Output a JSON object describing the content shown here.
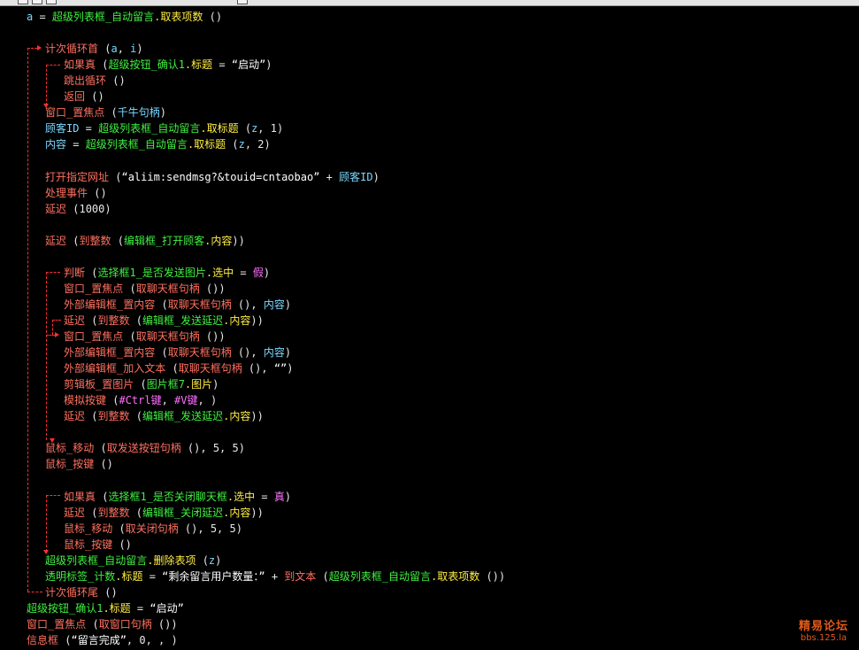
{
  "code": {
    "lines": [
      [
        {
          "t": "a",
          "c": "c-var"
        },
        {
          "t": " = ",
          "c": "c-op"
        },
        {
          "t": "超级列表框_自动留言",
          "c": "c-obj"
        },
        {
          "t": ".取表项数",
          "c": "c-fn"
        },
        {
          "t": " ()",
          "c": "c-op"
        }
      ],
      [],
      [
        {
          "t": "计次循环首",
          "c": "c-kw"
        },
        {
          "t": " (",
          "c": "c-op"
        },
        {
          "t": "a",
          "c": "c-var"
        },
        {
          "t": ", ",
          "c": "c-op"
        },
        {
          "t": "i",
          "c": "c-var"
        },
        {
          "t": ")",
          "c": "c-op"
        }
      ],
      [
        {
          "t": "如果真",
          "c": "c-kw"
        },
        {
          "t": " (",
          "c": "c-op"
        },
        {
          "t": "超级按钮_确认1",
          "c": "c-obj"
        },
        {
          "t": ".标题",
          "c": "c-fn"
        },
        {
          "t": " = ",
          "c": "c-op"
        },
        {
          "t": "“启动”",
          "c": "c-str"
        },
        {
          "t": ")",
          "c": "c-op"
        }
      ],
      [
        {
          "t": "跳出循环",
          "c": "c-kw"
        },
        {
          "t": " ()",
          "c": "c-op"
        }
      ],
      [
        {
          "t": "返回",
          "c": "c-kw"
        },
        {
          "t": " ()",
          "c": "c-op"
        }
      ],
      [
        {
          "t": "窗口_置焦点",
          "c": "c-kw"
        },
        {
          "t": " (",
          "c": "c-op"
        },
        {
          "t": "千牛句柄",
          "c": "c-var"
        },
        {
          "t": ")",
          "c": "c-op"
        }
      ],
      [
        {
          "t": "顾客ID",
          "c": "c-var"
        },
        {
          "t": " = ",
          "c": "c-op"
        },
        {
          "t": "超级列表框_自动留言",
          "c": "c-obj"
        },
        {
          "t": ".取标题",
          "c": "c-fn"
        },
        {
          "t": " (",
          "c": "c-op"
        },
        {
          "t": "z",
          "c": "c-var"
        },
        {
          "t": ", 1)",
          "c": "c-num"
        }
      ],
      [
        {
          "t": "内容",
          "c": "c-var"
        },
        {
          "t": " = ",
          "c": "c-op"
        },
        {
          "t": "超级列表框_自动留言",
          "c": "c-obj"
        },
        {
          "t": ".取标题",
          "c": "c-fn"
        },
        {
          "t": " (",
          "c": "c-op"
        },
        {
          "t": "z",
          "c": "c-var"
        },
        {
          "t": ", 2)",
          "c": "c-num"
        }
      ],
      [],
      [
        {
          "t": "打开指定网址",
          "c": "c-kw"
        },
        {
          "t": " (",
          "c": "c-op"
        },
        {
          "t": "“aliim:sendmsg?&touid=cntaobao”",
          "c": "c-str"
        },
        {
          "t": " + ",
          "c": "c-op"
        },
        {
          "t": "顾客ID",
          "c": "c-var"
        },
        {
          "t": ")",
          "c": "c-op"
        }
      ],
      [
        {
          "t": "处理事件",
          "c": "c-kw"
        },
        {
          "t": " ()",
          "c": "c-op"
        }
      ],
      [
        {
          "t": "延迟",
          "c": "c-kw"
        },
        {
          "t": " (1000)",
          "c": "c-num"
        }
      ],
      [],
      [
        {
          "t": "延迟",
          "c": "c-kw"
        },
        {
          "t": " (",
          "c": "c-op"
        },
        {
          "t": "到整数",
          "c": "c-kw"
        },
        {
          "t": " (",
          "c": "c-op"
        },
        {
          "t": "编辑框_打开顾客",
          "c": "c-obj"
        },
        {
          "t": ".内容",
          "c": "c-fn"
        },
        {
          "t": "))",
          "c": "c-op"
        }
      ],
      [],
      [
        {
          "t": "判断",
          "c": "c-kw"
        },
        {
          "t": " (",
          "c": "c-op"
        },
        {
          "t": "选择框1_是否发送图片",
          "c": "c-obj"
        },
        {
          "t": ".选中",
          "c": "c-fn"
        },
        {
          "t": " = ",
          "c": "c-op"
        },
        {
          "t": "假",
          "c": "c-bool"
        },
        {
          "t": ")",
          "c": "c-op"
        }
      ],
      [
        {
          "t": "窗口_置焦点",
          "c": "c-kw"
        },
        {
          "t": " (",
          "c": "c-op"
        },
        {
          "t": "取聊天框句柄",
          "c": "c-kw"
        },
        {
          "t": " ())",
          "c": "c-op"
        }
      ],
      [
        {
          "t": "外部编辑框_置内容",
          "c": "c-kw"
        },
        {
          "t": " (",
          "c": "c-op"
        },
        {
          "t": "取聊天框句柄",
          "c": "c-kw"
        },
        {
          "t": " (), ",
          "c": "c-op"
        },
        {
          "t": "内容",
          "c": "c-var"
        },
        {
          "t": ")",
          "c": "c-op"
        }
      ],
      [
        {
          "t": "延迟",
          "c": "c-kw"
        },
        {
          "t": " (",
          "c": "c-op"
        },
        {
          "t": "到整数",
          "c": "c-kw"
        },
        {
          "t": " (",
          "c": "c-op"
        },
        {
          "t": "编辑框_发送延迟",
          "c": "c-obj"
        },
        {
          "t": ".内容",
          "c": "c-fn"
        },
        {
          "t": "))",
          "c": "c-op"
        }
      ],
      [
        {
          "t": "窗口_置焦点",
          "c": "c-kw"
        },
        {
          "t": " (",
          "c": "c-op"
        },
        {
          "t": "取聊天框句柄",
          "c": "c-kw"
        },
        {
          "t": " ())",
          "c": "c-op"
        }
      ],
      [
        {
          "t": "外部编辑框_置内容",
          "c": "c-kw"
        },
        {
          "t": " (",
          "c": "c-op"
        },
        {
          "t": "取聊天框句柄",
          "c": "c-kw"
        },
        {
          "t": " (), ",
          "c": "c-op"
        },
        {
          "t": "内容",
          "c": "c-var"
        },
        {
          "t": ")",
          "c": "c-op"
        }
      ],
      [
        {
          "t": "外部编辑框_加入文本",
          "c": "c-kw"
        },
        {
          "t": " (",
          "c": "c-op"
        },
        {
          "t": "取聊天框句柄",
          "c": "c-kw"
        },
        {
          "t": " (), ",
          "c": "c-op"
        },
        {
          "t": "“”",
          "c": "c-str"
        },
        {
          "t": ")",
          "c": "c-op"
        }
      ],
      [
        {
          "t": "剪辑板_置图片",
          "c": "c-kw"
        },
        {
          "t": " (",
          "c": "c-op"
        },
        {
          "t": "图片框7",
          "c": "c-obj"
        },
        {
          "t": ".图片",
          "c": "c-fn"
        },
        {
          "t": ")",
          "c": "c-op"
        }
      ],
      [
        {
          "t": "模拟按键",
          "c": "c-kw"
        },
        {
          "t": " (",
          "c": "c-op"
        },
        {
          "t": "#Ctrl键",
          "c": "c-bool"
        },
        {
          "t": ", ",
          "c": "c-op"
        },
        {
          "t": "#V键",
          "c": "c-bool"
        },
        {
          "t": ", )",
          "c": "c-op"
        }
      ],
      [
        {
          "t": "延迟",
          "c": "c-kw"
        },
        {
          "t": " (",
          "c": "c-op"
        },
        {
          "t": "到整数",
          "c": "c-kw"
        },
        {
          "t": " (",
          "c": "c-op"
        },
        {
          "t": "编辑框_发送延迟",
          "c": "c-obj"
        },
        {
          "t": ".内容",
          "c": "c-fn"
        },
        {
          "t": "))",
          "c": "c-op"
        }
      ],
      [],
      [
        {
          "t": "鼠标_移动",
          "c": "c-kw"
        },
        {
          "t": " (",
          "c": "c-op"
        },
        {
          "t": "取发送按钮句柄",
          "c": "c-kw"
        },
        {
          "t": " (), 5, 5)",
          "c": "c-op"
        }
      ],
      [
        {
          "t": "鼠标_按键",
          "c": "c-kw"
        },
        {
          "t": " ()",
          "c": "c-op"
        }
      ],
      [],
      [
        {
          "t": "如果真",
          "c": "c-kw"
        },
        {
          "t": " (",
          "c": "c-op"
        },
        {
          "t": "选择框1_是否关闭聊天框",
          "c": "c-obj"
        },
        {
          "t": ".选中",
          "c": "c-fn"
        },
        {
          "t": " = ",
          "c": "c-op"
        },
        {
          "t": "真",
          "c": "c-bool"
        },
        {
          "t": ")",
          "c": "c-op"
        }
      ],
      [
        {
          "t": "延迟",
          "c": "c-kw"
        },
        {
          "t": " (",
          "c": "c-op"
        },
        {
          "t": "到整数",
          "c": "c-kw"
        },
        {
          "t": " (",
          "c": "c-op"
        },
        {
          "t": "编辑框_关闭延迟",
          "c": "c-obj"
        },
        {
          "t": ".内容",
          "c": "c-fn"
        },
        {
          "t": "))",
          "c": "c-op"
        }
      ],
      [
        {
          "t": "鼠标_移动",
          "c": "c-kw"
        },
        {
          "t": " (",
          "c": "c-op"
        },
        {
          "t": "取关闭句柄",
          "c": "c-kw"
        },
        {
          "t": " (), 5, 5)",
          "c": "c-op"
        }
      ],
      [
        {
          "t": "鼠标_按键",
          "c": "c-kw"
        },
        {
          "t": " ()",
          "c": "c-op"
        }
      ],
      [
        {
          "t": "超级列表框_自动留言",
          "c": "c-obj"
        },
        {
          "t": ".删除表项",
          "c": "c-fn"
        },
        {
          "t": " (",
          "c": "c-op"
        },
        {
          "t": "z",
          "c": "c-var"
        },
        {
          "t": ")",
          "c": "c-op"
        }
      ],
      [
        {
          "t": "透明标签_计数",
          "c": "c-obj"
        },
        {
          "t": ".标题",
          "c": "c-fn"
        },
        {
          "t": " = ",
          "c": "c-op"
        },
        {
          "t": "“剩余留言用户数量：”",
          "c": "c-str"
        },
        {
          "t": " + ",
          "c": "c-op"
        },
        {
          "t": "到文本",
          "c": "c-kw"
        },
        {
          "t": " (",
          "c": "c-op"
        },
        {
          "t": "超级列表框_自动留言",
          "c": "c-obj"
        },
        {
          "t": ".取表项数",
          "c": "c-fn"
        },
        {
          "t": " ())",
          "c": "c-op"
        }
      ],
      [
        {
          "t": "计次循环尾",
          "c": "c-kw"
        },
        {
          "t": " ()",
          "c": "c-op"
        }
      ],
      [
        {
          "t": "超级按钮_确认1",
          "c": "c-obj"
        },
        {
          "t": ".标题",
          "c": "c-fn"
        },
        {
          "t": " = ",
          "c": "c-op"
        },
        {
          "t": "“启动”",
          "c": "c-str"
        }
      ],
      [
        {
          "t": "窗口_置焦点",
          "c": "c-kw"
        },
        {
          "t": " (",
          "c": "c-op"
        },
        {
          "t": "取窗口句柄",
          "c": "c-kw"
        },
        {
          "t": " ())",
          "c": "c-op"
        }
      ],
      [
        {
          "t": "信息框",
          "c": "c-kw"
        },
        {
          "t": " (",
          "c": "c-op"
        },
        {
          "t": "“留言完成”",
          "c": "c-str"
        },
        {
          "t": ", 0, , )",
          "c": "c-op"
        }
      ]
    ]
  },
  "watermark": {
    "line1": "精易论坛",
    "line2": "bbs.125.la"
  }
}
